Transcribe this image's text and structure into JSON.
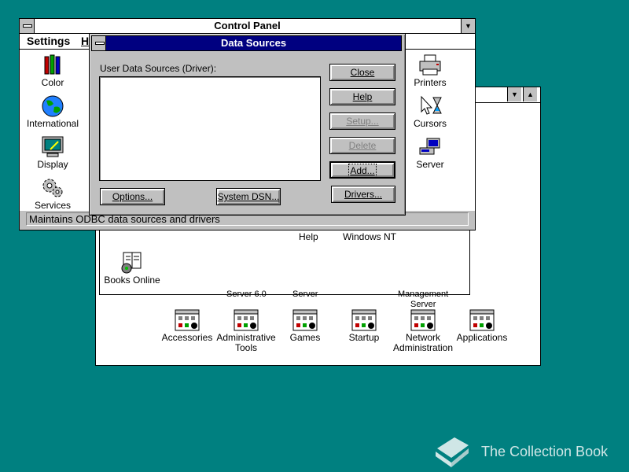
{
  "background_color": "#008080",
  "program_manager_window": {
    "groups_row1": [
      {
        "label": "Help",
        "icon": "help-icon"
      },
      {
        "label": "Windows NT",
        "icon": "windows-nt-icon"
      }
    ],
    "cut_labels": [
      "Server 6.0",
      "Server",
      "Management",
      "Server"
    ],
    "books_online": {
      "label": "Books Online",
      "icon": "books-online-icon"
    },
    "groups": [
      {
        "label": "Accessories",
        "icon": "program-group-icon"
      },
      {
        "label": "Administrative Tools",
        "icon": "program-group-icon"
      },
      {
        "label": "Games",
        "icon": "program-group-icon"
      },
      {
        "label": "Startup",
        "icon": "program-group-icon"
      },
      {
        "label": "Network Administration",
        "icon": "program-group-icon"
      },
      {
        "label": "Applications",
        "icon": "program-group-icon"
      }
    ]
  },
  "control_panel": {
    "title": "Control Panel",
    "menu": {
      "settings": "Settings",
      "help": "H"
    },
    "left_icons": [
      {
        "label": "Color",
        "icon": "color-icon"
      },
      {
        "label": "International",
        "icon": "globe-icon"
      },
      {
        "label": "Display",
        "icon": "display-icon"
      },
      {
        "label": "Services",
        "icon": "services-icon"
      }
    ],
    "right_icons": [
      {
        "label": "Printers",
        "icon": "printer-icon"
      },
      {
        "label": "Cursors",
        "icon": "cursor-icon"
      },
      {
        "label": "Server",
        "icon": "server-icon"
      }
    ],
    "status": "Maintains ODBC data sources and drivers"
  },
  "data_sources_dialog": {
    "title": "Data Sources",
    "list_label": "User Data Sources (Driver):",
    "buttons": {
      "close": "Close",
      "help": "Help",
      "setup": "Setup...",
      "delete": "Delete",
      "add": "Add...",
      "drivers": "Drivers...",
      "options": "Options...",
      "system_dsn": "System DSN..."
    }
  },
  "watermark": {
    "text": "The Collection Book",
    "icon": "book-icon"
  }
}
